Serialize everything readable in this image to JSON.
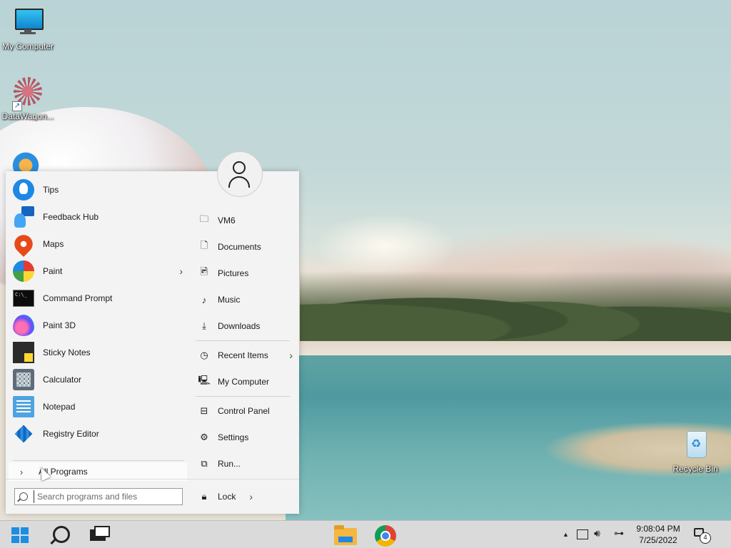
{
  "desktop": {
    "icons": [
      {
        "label": "My Computer",
        "icon": "monitor-icon"
      },
      {
        "label": "DataWagon...",
        "icon": "datawagon-icon"
      },
      {
        "label": "Recycle Bin",
        "icon": "recycle-bin-icon"
      }
    ]
  },
  "start_menu": {
    "apps": [
      {
        "label": "Tips",
        "icon": "lightbulb-icon"
      },
      {
        "label": "Feedback Hub",
        "icon": "feedback-icon"
      },
      {
        "label": "Maps",
        "icon": "map-pin-icon"
      },
      {
        "label": "Paint",
        "icon": "palette-icon",
        "has_submenu": true
      },
      {
        "label": "Command Prompt",
        "icon": "terminal-icon"
      },
      {
        "label": "Paint 3D",
        "icon": "paint3d-icon"
      },
      {
        "label": "Sticky Notes",
        "icon": "sticky-note-icon"
      },
      {
        "label": "Calculator",
        "icon": "calculator-icon"
      },
      {
        "label": "Notepad",
        "icon": "notepad-icon"
      },
      {
        "label": "Registry Editor",
        "icon": "registry-icon"
      }
    ],
    "all_programs_label": "All Programs",
    "search_placeholder": "Search programs and files",
    "places": [
      {
        "label": "VM6",
        "icon": "user-folder-icon"
      },
      {
        "label": "Documents",
        "icon": "document-icon"
      },
      {
        "label": "Pictures",
        "icon": "picture-icon"
      },
      {
        "label": "Music",
        "icon": "music-icon"
      },
      {
        "label": "Downloads",
        "icon": "download-icon"
      },
      {
        "label": "Recent Items",
        "icon": "clock-icon",
        "has_submenu": true
      },
      {
        "label": "My Computer",
        "icon": "computer-icon"
      },
      {
        "label": "Control Panel",
        "icon": "control-panel-icon"
      },
      {
        "label": "Settings",
        "icon": "gear-icon"
      },
      {
        "label": "Run...",
        "icon": "run-icon"
      }
    ],
    "lock_label": "Lock"
  },
  "taskbar": {
    "time": "9:08:04 PM",
    "date": "7/25/2022",
    "notification_count": "4"
  },
  "colors": {
    "accent": "#1c8de3",
    "menu_bg": "#f3f3f3",
    "taskbar_bg": "#dadada"
  }
}
